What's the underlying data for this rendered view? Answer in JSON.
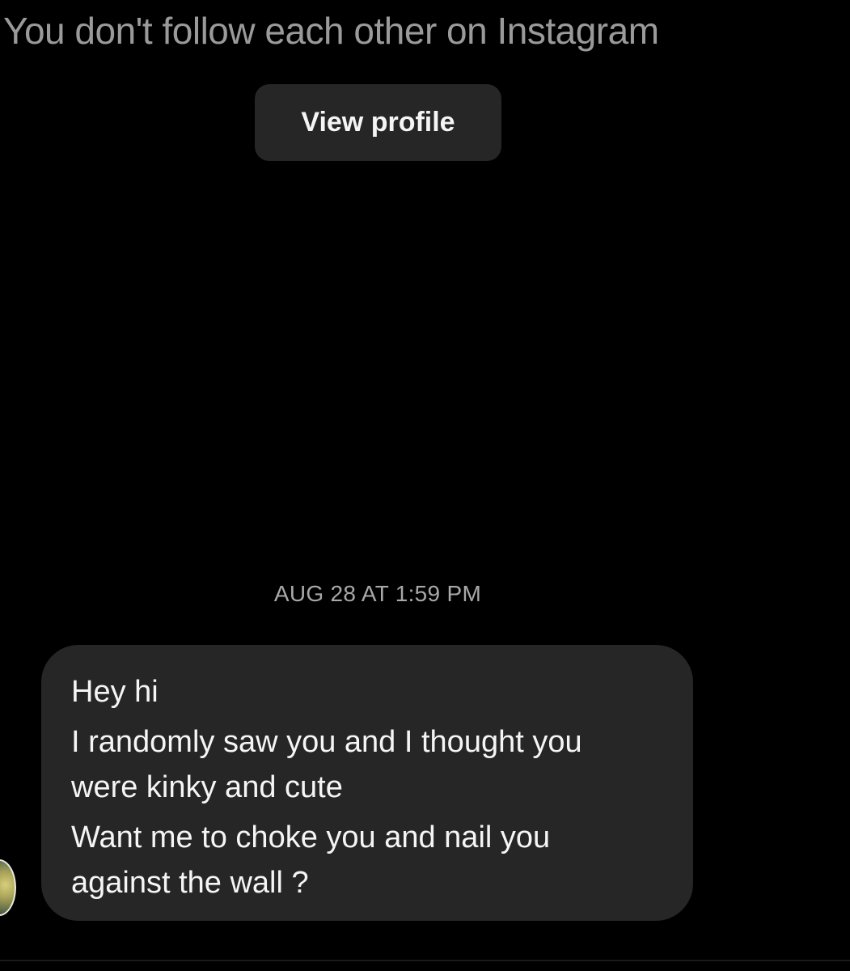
{
  "thread": {
    "follow_status": "You don't follow each other on Instagram",
    "view_profile_label": "View profile",
    "timestamp": "AUG 28 AT 1:59 PM"
  },
  "message": {
    "lines": [
      "Hey hi",
      "I randomly saw you and I thought you",
      "were kinky and cute",
      "Want me to choke you and nail you",
      "against the wall ?"
    ]
  },
  "colors": {
    "background": "#000000",
    "bubble": "#262626",
    "button": "#262626",
    "muted_text": "#9a9a9a",
    "primary_text": "#f5f5f5"
  }
}
